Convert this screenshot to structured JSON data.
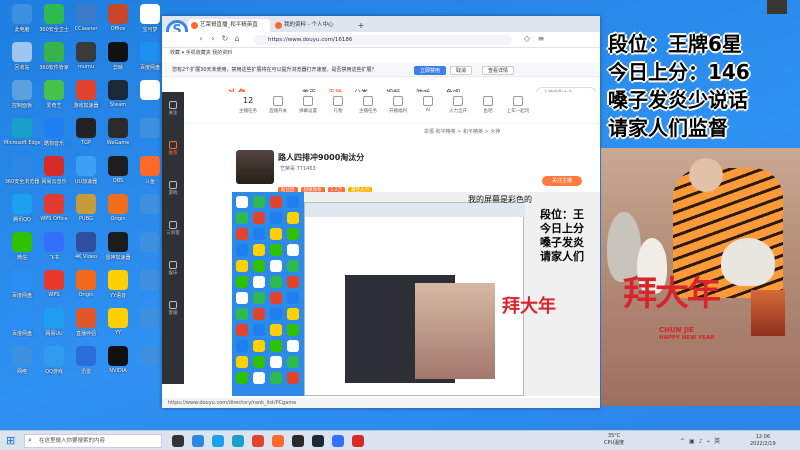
{
  "desktop": {
    "icons": [
      {
        "label": "此电脑",
        "color": "#3d8fe0"
      },
      {
        "label": "360安全卫士",
        "color": "#2dba4e"
      },
      {
        "label": "CCleaner",
        "color": "#3b7bc8"
      },
      {
        "label": "Office",
        "color": "#c9452a"
      },
      {
        "label": "宝可梦",
        "color": "#fff"
      },
      {
        "label": "回收站",
        "color": "#9cc6ef"
      },
      {
        "label": "360软件管家",
        "color": "#37b34a"
      },
      {
        "label": "mumu",
        "color": "#3a3a3a"
      },
      {
        "label": "剪映",
        "color": "#111"
      },
      {
        "label": "百度网盘",
        "color": "#1e8ef0"
      },
      {
        "label": "控制面板",
        "color": "#5aa0dd"
      },
      {
        "label": "爱奇艺",
        "color": "#46c24a"
      },
      {
        "label": "游戏加速器",
        "color": "#e2432c"
      },
      {
        "label": "Steam",
        "color": "#1b2838"
      },
      {
        "label": "",
        "color": "#fff"
      },
      {
        "label": "Microsoft Edge",
        "color": "#18a0c8"
      },
      {
        "label": "酷狗音乐",
        "color": "#1d7ff0"
      },
      {
        "label": "TGP",
        "color": "#222"
      },
      {
        "label": "WeGame",
        "color": "#2a2a2a"
      },
      {
        "label": "",
        "color": "#3d8fe0"
      },
      {
        "label": "360安全浏览器",
        "color": "#2c87e5"
      },
      {
        "label": "网易云音乐",
        "color": "#d92a2a"
      },
      {
        "label": "UU加速器",
        "color": "#3da0f5"
      },
      {
        "label": "OBS",
        "color": "#1e1e1e"
      },
      {
        "label": "斗鱼",
        "color": "#ff6a2b"
      },
      {
        "label": "腾讯QQ",
        "color": "#1ea0f0"
      },
      {
        "label": "WPS Office",
        "color": "#e33c2f"
      },
      {
        "label": "PUBG",
        "color": "#c79a3b"
      },
      {
        "label": "Origin",
        "color": "#f06d1e"
      },
      {
        "label": "",
        "color": "#3d8fe0"
      },
      {
        "label": "微信",
        "color": "#2dc100"
      },
      {
        "label": "飞书",
        "color": "#3370ff"
      },
      {
        "label": "4K Video",
        "color": "#2f4f9c"
      },
      {
        "label": "雷神加速器",
        "color": "#1c1c1c"
      },
      {
        "label": "",
        "color": "#3d8fe0"
      },
      {
        "label": "百度网盘",
        "color": "#2a8ef5"
      },
      {
        "label": "WPS",
        "color": "#e8392c"
      },
      {
        "label": "Origin",
        "color": "#f56a1a"
      },
      {
        "label": "YY语音",
        "color": "#ffd100"
      },
      {
        "label": "",
        "color": "#3d8fe0"
      },
      {
        "label": "百度网盘",
        "color": "#2a8ef5"
      },
      {
        "label": "网易UU",
        "color": "#1f9ef2"
      },
      {
        "label": "直播伴侣",
        "color": "#e0572b"
      },
      {
        "label": "YY",
        "color": "#ffd000"
      },
      {
        "label": "",
        "color": "#3d8fe0"
      },
      {
        "label": "网络",
        "color": "#3d8fe0"
      },
      {
        "label": "QQ游戏",
        "color": "#2f9cf0"
      },
      {
        "label": "迅雷",
        "color": "#2a6fd8"
      },
      {
        "label": "NVIDIA",
        "color": "#111"
      },
      {
        "label": "",
        "color": "#3d8fe0"
      }
    ]
  },
  "browser": {
    "tabs": [
      {
        "label": "艺荣哥直播_和平精英直",
        "color": "#ff6a2b"
      },
      {
        "label": "我的资料 - 个人中心",
        "color": "#ff6a2b"
      }
    ],
    "url": "https://www.douyu.com/16186",
    "bookmarks": "收藏 ▾   手机收藏夹   我的资料",
    "notice": "您有2个扩展30天未使用，禁用这些扩展将在可以提升浏览器打开速度。是否禁用这些扩展？",
    "notice_btn_primary": "立即禁用",
    "notice_btn_cancel": "取消",
    "notice_btn_detail": "查看详情",
    "status": "https://www.douyu.com/directory/rank_list/PCgame"
  },
  "douyu": {
    "logo": "斗鱼",
    "nav": [
      "首页",
      "直播",
      "分类",
      "视频",
      "游戏",
      "鱼吧"
    ],
    "search_placeholder": "上榜电影大片",
    "leftbar": [
      "关注",
      "推荐",
      "游戏",
      "三剑客",
      "娱乐",
      "客服"
    ],
    "tools": [
      {
        "label": "主播任务",
        "num": "12"
      },
      {
        "label": "直播开关"
      },
      {
        "label": "弹幕设置"
      },
      {
        "label": "礼物"
      },
      {
        "label": "主播任务"
      },
      {
        "label": "开播福利"
      },
      {
        "label": "AI"
      },
      {
        "label": "火力全开"
      },
      {
        "label": "鱼吧"
      },
      {
        "label": "上车一起玩"
      }
    ],
    "room_title": "路人四排冲9000淘汰分",
    "room_meta": "举报   和平精英 > 和平精英 > 大神",
    "anchor_name": "艺荣哥",
    "anchor_id": "771463",
    "tags": [
      "粉丝团",
      "超级勋章",
      "1.2万",
      "最佳火力"
    ],
    "follow_btn": "关注主播"
  },
  "stream": {
    "screen_caption": "我的屏幕是彩色的",
    "inner_overlay": "段位：王\n今日上分\n嗓子发炎\n请家人们",
    "baidu": "拜大年",
    "chunjie": "CHUN JIE",
    "hny": "HAPPY NEW YEAR"
  },
  "overlay": {
    "line1": "段位：王牌6星",
    "line2": "今日上分：146",
    "line3": "嗓子发炎少说话",
    "line4": "请家人们监督"
  },
  "taskbar": {
    "search_placeholder": "在这里输入你要搜索的内容",
    "cpu_temp": "35°C",
    "cpu_label": "CPU温度",
    "time": "12:06",
    "date": "2022/2/19"
  }
}
